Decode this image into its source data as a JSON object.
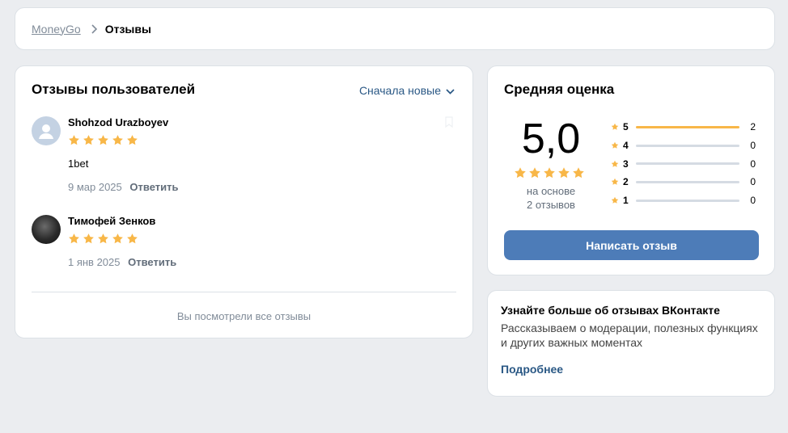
{
  "breadcrumb": {
    "parent": "MoneyGo",
    "current": "Отзывы"
  },
  "reviews": {
    "title": "Отзывы пользователей",
    "sort_label": "Сначала новые",
    "items": [
      {
        "author": "Shohzod Urazboyev",
        "rating": 5,
        "text": "1bet",
        "date": "9 мар 2025",
        "reply_label": "Ответить"
      },
      {
        "author": "Тимофей Зенков",
        "rating": 5,
        "text": "",
        "date": "1 янв 2025",
        "reply_label": "Ответить"
      }
    ],
    "footer": "Вы посмотрели все отзывы"
  },
  "average": {
    "title": "Средняя оценка",
    "score": "5,0",
    "rating": 5,
    "basis_line1": "на основе",
    "basis_line2": "2 отзывов",
    "distribution": [
      {
        "stars": "5",
        "count": "2",
        "fraction": 1.0
      },
      {
        "stars": "4",
        "count": "0",
        "fraction": 0
      },
      {
        "stars": "3",
        "count": "0",
        "fraction": 0
      },
      {
        "stars": "2",
        "count": "0",
        "fraction": 0
      },
      {
        "stars": "1",
        "count": "0",
        "fraction": 0
      }
    ],
    "button_label": "Написать отзыв"
  },
  "info": {
    "title": "Узнайте больше об отзывах ВКонтакте",
    "text": "Рассказываем о модерации, полезных функциях и других важных моментах",
    "link": "Подробнее"
  },
  "colors": {
    "star": "#f8b748",
    "accent": "#4d7cb8",
    "link": "#2a5885"
  }
}
